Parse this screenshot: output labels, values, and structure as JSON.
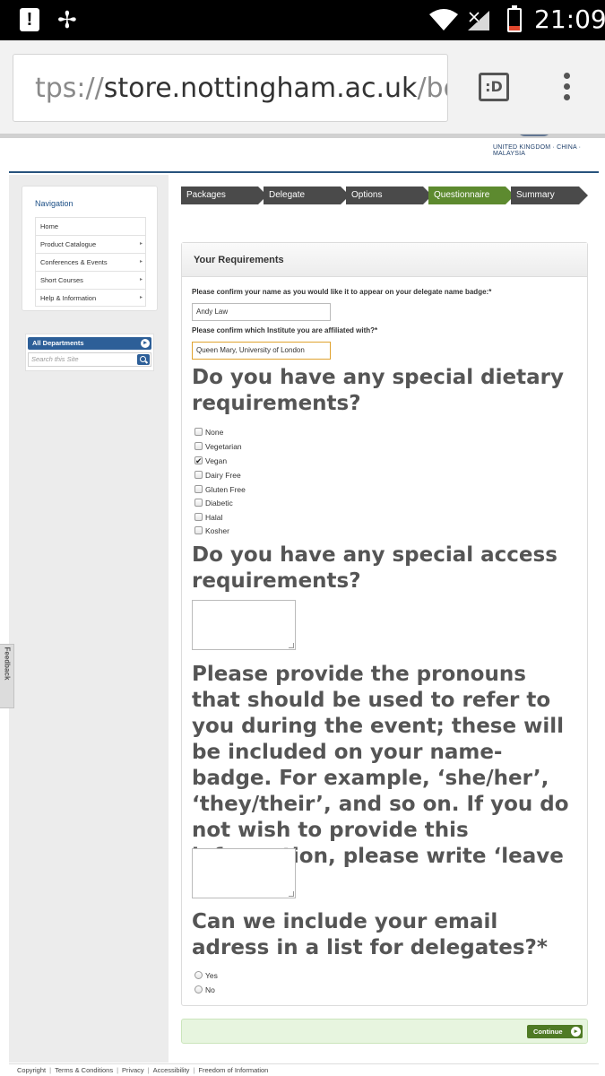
{
  "status_bar": {
    "time": "21:09",
    "alert_glyph": "!",
    "pinwheel_icon": "pinwheel-icon",
    "wifi_icon": "wifi-icon",
    "signal_icon": "signal-icon",
    "battery_icon": "battery-icon"
  },
  "browser": {
    "url_prefix": "tps://",
    "url_host": "store.nottingham.ac.uk",
    "url_path": "/boo",
    "tab_switcher_label": ":D"
  },
  "site": {
    "logo_tagline": "UNITED KINGDOM · CHINA · MALAYSIA"
  },
  "navigation": {
    "title": "Navigation",
    "items": [
      {
        "label": "Home",
        "arrow": ""
      },
      {
        "label": "Product Catalogue",
        "arrow": "▸"
      },
      {
        "label": "Conferences & Events",
        "arrow": "▸"
      },
      {
        "label": "Short Courses",
        "arrow": "▸"
      },
      {
        "label": "Help & Information",
        "arrow": "▸"
      }
    ]
  },
  "departments": {
    "label": "All Departments",
    "go": "▸",
    "search_placeholder": "Search this Site"
  },
  "feedback_tab": "Feedback",
  "steps": [
    {
      "label": "Packages",
      "active": false
    },
    {
      "label": "Delegate",
      "active": false
    },
    {
      "label": "Options",
      "active": false
    },
    {
      "label": "Questionnaire",
      "active": true
    },
    {
      "label": "Summary",
      "active": false
    }
  ],
  "requirements": {
    "heading": "Your Requirements",
    "name_label": "Please confirm your name as you would like it to appear on your delegate name badge:*",
    "name_value": "Andy Law",
    "institute_label": "Please confirm which Institute you are affiliated with?*",
    "institute_value": "Queen Mary, University of London",
    "dietary_question": "Do you have any special dietary requirements?",
    "dietary_options": [
      {
        "label": "None",
        "checked": false
      },
      {
        "label": "Vegetarian",
        "checked": false
      },
      {
        "label": "Vegan",
        "checked": true
      },
      {
        "label": "Dairy Free",
        "checked": false
      },
      {
        "label": "Gluten Free",
        "checked": false
      },
      {
        "label": "Diabetic",
        "checked": false
      },
      {
        "label": "Halal",
        "checked": false
      },
      {
        "label": "Kosher",
        "checked": false
      }
    ],
    "access_question": "Do you have any special access requirements?",
    "pronoun_question": "Please provide the pronouns that should be used to refer to you during the event; these will be included on your name-badge. For example, ‘she/her’, ‘they/their’, and so on. If you do not wish to provide this information, please write ‘leave blank’",
    "email_question": "Can we include your email adress in a list for delegates?*",
    "email_options": [
      {
        "label": "Yes",
        "selected": false
      },
      {
        "label": "No",
        "selected": false
      }
    ]
  },
  "continue_label": "Continue",
  "footer_links": [
    "Copyright",
    "Terms & Conditions",
    "Privacy",
    "Accessibility",
    "Freedom of Information"
  ]
}
